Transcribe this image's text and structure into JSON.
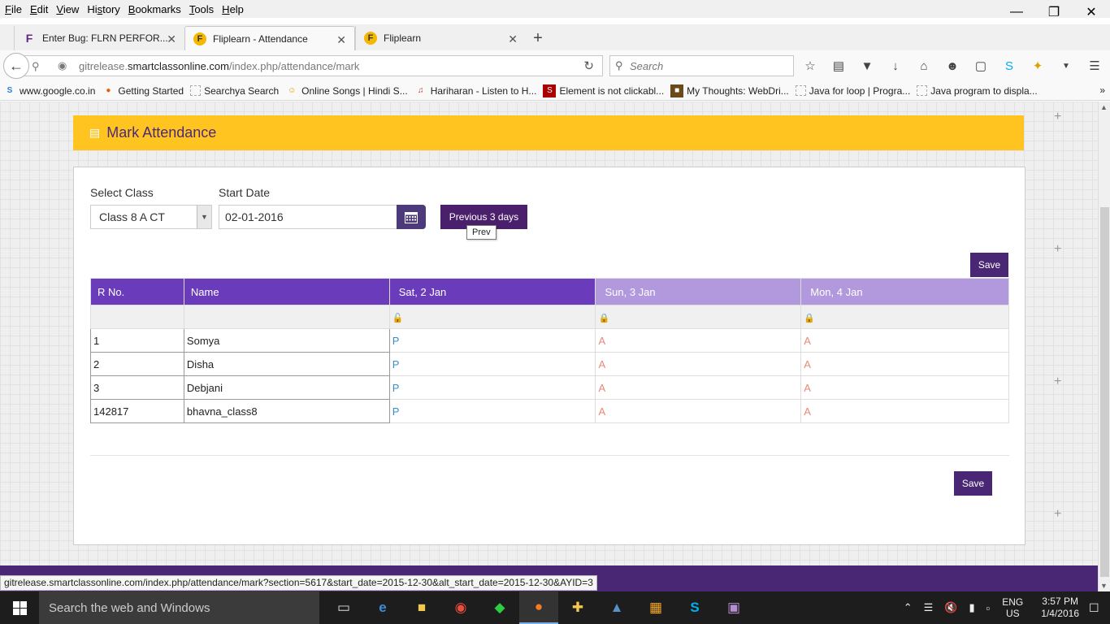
{
  "menu": [
    "File",
    "Edit",
    "View",
    "History",
    "Bookmarks",
    "Tools",
    "Help"
  ],
  "menu_underline": [
    "F",
    "E",
    "V",
    "s",
    "B",
    "T",
    "H"
  ],
  "tabs": [
    {
      "title": "Enter Bug: FLRN PERFOR...",
      "icon": "fliplearn-f-icon"
    },
    {
      "title": "Fliplearn - Attendance",
      "icon": "fliplearn-logo-icon",
      "active": true
    },
    {
      "title": "Fliplearn",
      "icon": "fliplearn-logo-icon"
    }
  ],
  "url": {
    "prefix": "gitrelease.",
    "host": "smartclassonline.com",
    "path": "/index.php/attendance/mark"
  },
  "search_placeholder": "Search",
  "bookmarks": [
    "www.google.co.in",
    "Getting Started",
    "Searchya Search",
    "Online Songs | Hindi S...",
    "Hariharan - Listen to H...",
    "Element is not clickabl...",
    "My Thoughts: WebDri...",
    "Java for loop | Progra...",
    "Java program to displa..."
  ],
  "page": {
    "title": "Mark Attendance",
    "select_class_label": "Select Class",
    "select_class_value": "Class 8 A CT",
    "start_date_label": "Start Date",
    "start_date_value": "02-01-2016",
    "prev_button": "Previous 3 days",
    "tooltip": "Prev",
    "save_label": "Save"
  },
  "table": {
    "headers": [
      "R No.",
      "Name",
      "Sat, 2 Jan",
      "Sun, 3 Jan",
      "Mon, 4 Jan"
    ],
    "rows": [
      {
        "rno": "1",
        "name": "Somya",
        "d1": "P",
        "d2": "A",
        "d3": "A"
      },
      {
        "rno": "2",
        "name": "Disha",
        "d1": "P",
        "d2": "A",
        "d3": "A"
      },
      {
        "rno": "3",
        "name": "Debjani",
        "d1": "P",
        "d2": "A",
        "d3": "A"
      },
      {
        "rno": "142817",
        "name": "bhavna_class8",
        "d1": "P",
        "d2": "A",
        "d3": "A"
      }
    ]
  },
  "status_url": "gitrelease.smartclassonline.com/index.php/attendance/mark?section=5617&start_date=2015-12-30&alt_start_date=2015-12-30&AYID=3",
  "taskbar": {
    "search_placeholder": "Search the web and Windows",
    "lang_top": "ENG",
    "lang_bottom": "US",
    "time": "3:57 PM",
    "date": "1/4/2016"
  },
  "colors": {
    "accent": "#4a2775",
    "header_band": "#ffc41f",
    "present": "#3a8fc7",
    "absent": "#e8897a"
  }
}
